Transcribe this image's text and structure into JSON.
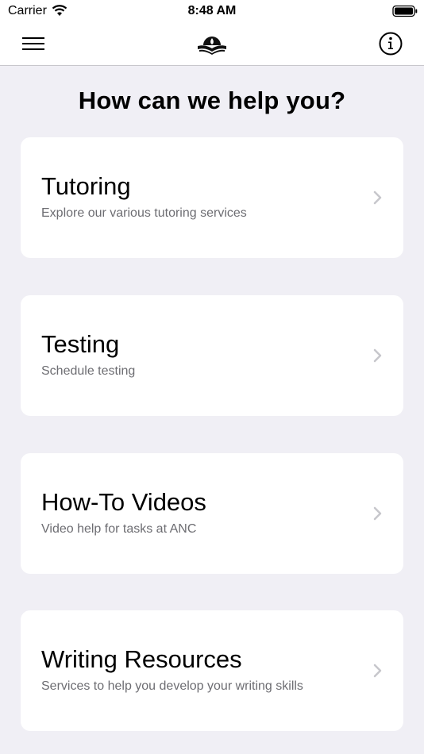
{
  "status_bar": {
    "carrier": "Carrier",
    "time": "8:48 AM"
  },
  "nav": {
    "left_icon": "hamburger-menu-icon",
    "center_icon": "open-book-logo-icon",
    "right_icon": "info-icon"
  },
  "main": {
    "title": "How can we help you?",
    "cards": [
      {
        "title": "Tutoring",
        "subtitle": "Explore our various tutoring services"
      },
      {
        "title": "Testing",
        "subtitle": "Schedule testing"
      },
      {
        "title": "How-To Videos",
        "subtitle": "Video help for tasks at ANC"
      },
      {
        "title": "Writing Resources",
        "subtitle": "Services to help you develop your writing skills"
      }
    ]
  },
  "colors": {
    "background": "#f0eff5",
    "card": "#ffffff",
    "subtitle": "#6d6d72",
    "chevron": "#c7c7cc"
  }
}
